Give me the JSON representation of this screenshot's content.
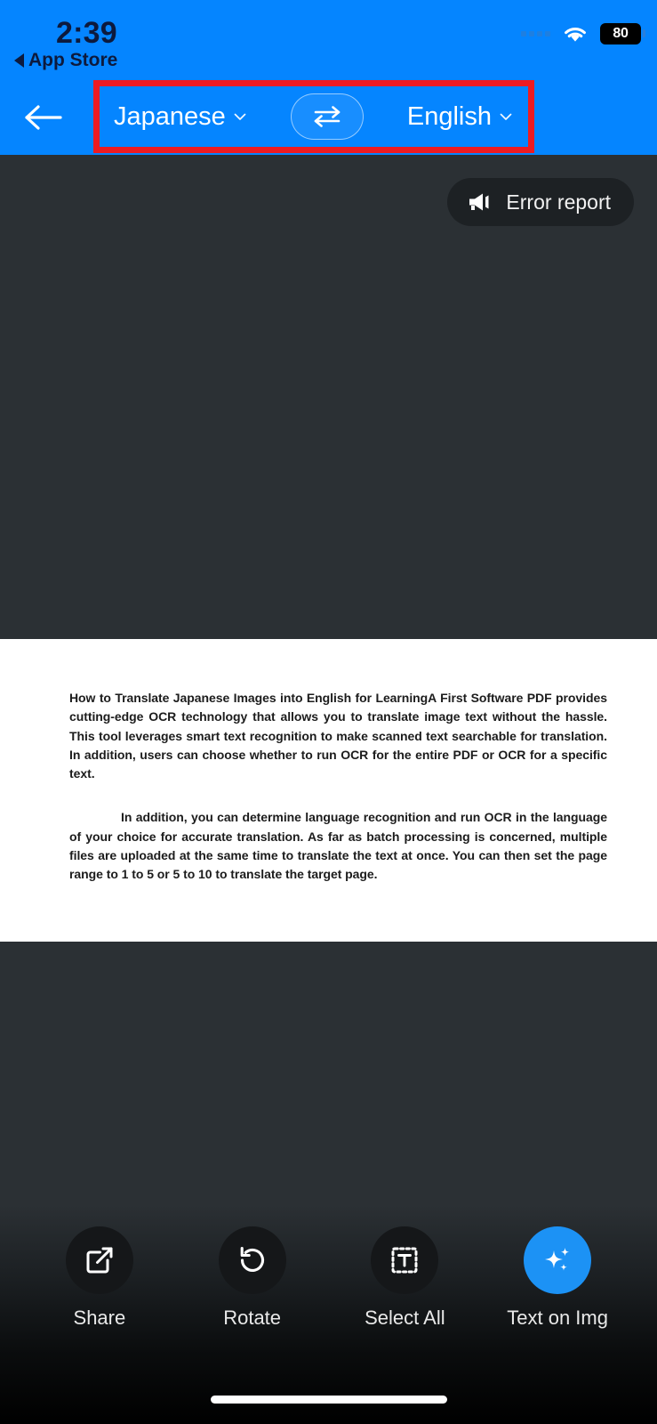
{
  "status_bar": {
    "time": "2:39",
    "back_app_label": "App Store",
    "back_app_icon": "triangle-left-icon",
    "signal_icon": "cellular-dots-icon",
    "wifi_icon": "wifi-icon",
    "battery_percent": "80"
  },
  "header": {
    "back_icon": "arrow-left-icon",
    "source_language": "Japanese",
    "source_chevron_icon": "chevron-down-icon",
    "target_language": "English",
    "target_chevron_icon": "chevron-down-icon",
    "swap_icon": "swap-horizontal-icon",
    "annotation_color": "#ee1b22",
    "background_color": "#0585ff"
  },
  "viewer": {
    "background_color": "#2b3034",
    "error_report": {
      "label": "Error report",
      "icon": "megaphone-icon"
    },
    "document": {
      "paragraphs": [
        "How to Translate Japanese Images into English for LearningA First Software PDF provides cutting-edge OCR technology that allows you to translate image text without the hassle. This tool leverages smart text recognition to make scanned text searchable for translation. In addition, users can choose whether to run OCR for the entire PDF or OCR for a specific text.",
        "In addition, you can determine language recognition and run OCR in the language of your choice for accurate translation. As far as batch processing is concerned, multiple files are uploaded at the same time to translate the text at once. You can then set the page range to 1 to 5 or 5 to 10 to translate the target page."
      ]
    }
  },
  "toolbar": {
    "items": [
      {
        "label": "Share",
        "icon": "share-export-icon",
        "accent": false
      },
      {
        "label": "Rotate",
        "icon": "rotate-counterclockwise-icon",
        "accent": false
      },
      {
        "label": "Select All",
        "icon": "select-text-region-icon",
        "accent": false
      },
      {
        "label": "Text on Img",
        "icon": "sparkles-icon",
        "accent": true
      }
    ],
    "accent_color": "#1c92f5"
  },
  "system": {
    "home_indicator": "home-indicator"
  }
}
